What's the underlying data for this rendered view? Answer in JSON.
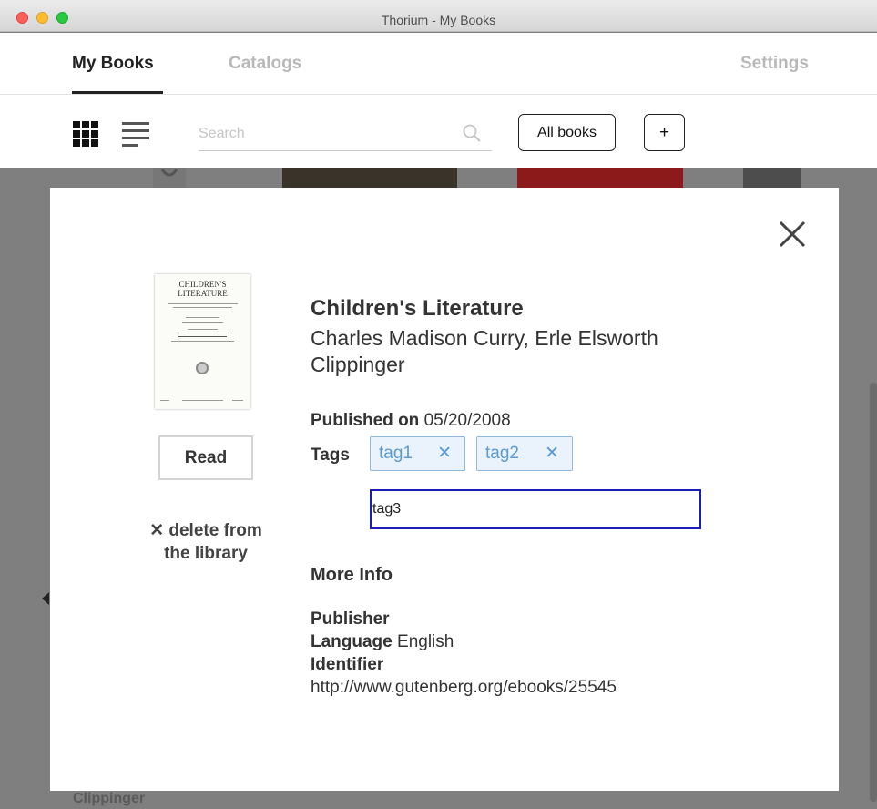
{
  "window": {
    "title": "Thorium - My Books"
  },
  "nav": {
    "tabs": [
      {
        "label": "My Books",
        "active": true
      },
      {
        "label": "Catalogs",
        "active": false
      }
    ],
    "settings_label": "Settings"
  },
  "toolbar": {
    "grid_view_icon": "grid-icon",
    "list_view_icon": "list-icon",
    "search": {
      "placeholder": "Search",
      "value": ""
    },
    "all_books_label": "All books",
    "add_label": "+"
  },
  "background": {
    "partial_text": "Clippinger"
  },
  "modal": {
    "close_icon": "close-icon",
    "cover": {
      "title_line1": "CHILDREN'S",
      "title_line2": "LITERATURE"
    },
    "read_label": "Read",
    "delete_label": "✕ delete from the library",
    "title": "Children's Literature",
    "authors": "Charles Madison Curry, Erle Elsworth Clippinger",
    "published_label": "Published on",
    "published_date": "05/20/2008",
    "tags_label": "Tags",
    "tags": [
      {
        "label": "tag1",
        "remove": "✕"
      },
      {
        "label": "tag2",
        "remove": "✕"
      }
    ],
    "tag_input_value": "tag3",
    "more_info_label": "More Info",
    "publisher_label": "Publisher",
    "publisher_value": "",
    "language_label": "Language",
    "language_value": "English",
    "identifier_label": "Identifier",
    "identifier_value": "http://www.gutenberg.org/ebooks/25545"
  },
  "colors": {
    "accent_input_border": "#1c1cb8",
    "tag_text": "#5a9bd5",
    "tag_bg": "#eaf3fb",
    "overlay": "#7f7f7f"
  }
}
